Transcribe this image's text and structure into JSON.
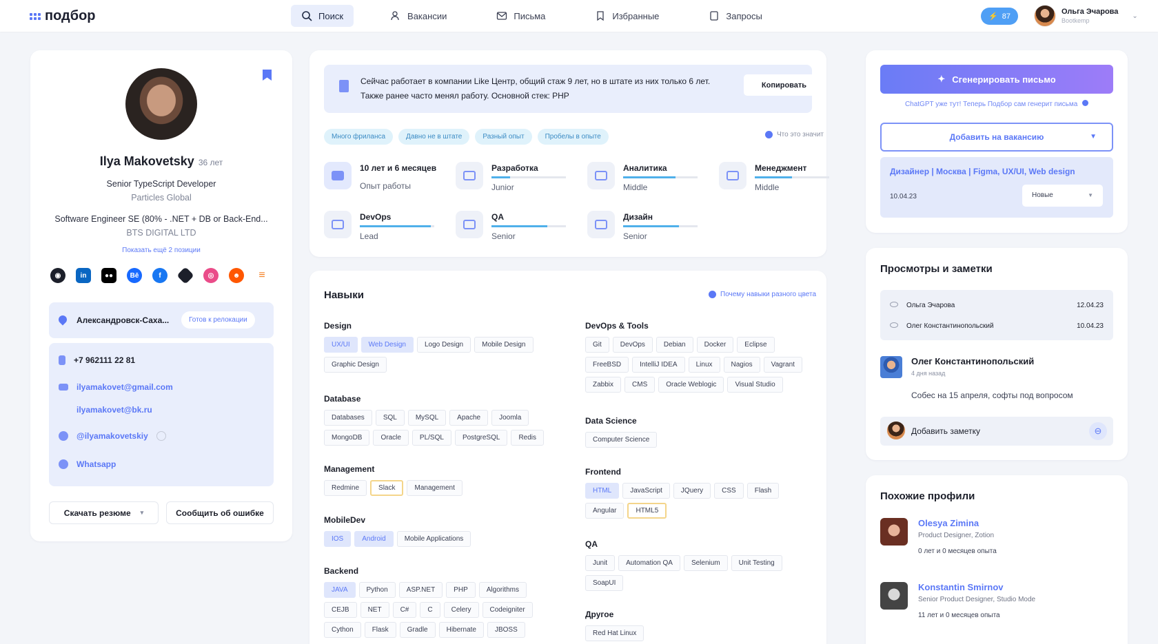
{
  "app": {
    "logo": "подбор"
  },
  "nav": [
    {
      "label": "Поиск",
      "icon": "search-icon"
    },
    {
      "label": "Вакансии",
      "icon": "people-icon"
    },
    {
      "label": "Письма",
      "icon": "mail-icon"
    },
    {
      "label": "Избранные",
      "icon": "bookmark-icon"
    },
    {
      "label": "Запросы",
      "icon": "document-icon"
    }
  ],
  "header": {
    "credits": "87",
    "user_name": "Ольга Эчарова",
    "user_role": "Bootkemp"
  },
  "profile": {
    "name": "Ilya Makovetsky",
    "age": "36 лет",
    "position": "Senior TypeScript Developer",
    "company": "Particles Global",
    "position2": "Software Engineer SE (80% - .NET + DB or Back-End...",
    "company2": "BTS DIGITAL LTD",
    "more_link": "Показать ещё 2 позиции",
    "socials": [
      "github",
      "linkedin",
      "medium",
      "behance",
      "facebook",
      "git",
      "dribbble",
      "reddit",
      "stackoverflow"
    ],
    "location": "Александровск-Саха...",
    "relocation": "Готов к релокации",
    "phone": "+7 962111 22 81",
    "email1": "ilyamakovet@gmail.com",
    "email2": "ilyamakovet@bk.ru",
    "telegram": "@ilyamakovetskiy",
    "whatsapp": "Whatsapp",
    "download": "Скачать резюме",
    "report": "Сообщить об ошибке"
  },
  "summary": {
    "text": "Сейчас работает в компании Like Центр, общий стаж 9 лет, но в штате из них только 6 лет. Также ранее часто менял работу. Основной стек: PHP",
    "copy": "Копировать",
    "tags": [
      "Много фриланса",
      "Давно не в штате",
      "Разный опыт",
      "Пробелы в опыте"
    ],
    "what": "Что это значит",
    "experience": "10 лет и 6 месяцев",
    "experience_label": "Опыт работы",
    "areas": [
      {
        "title": "Разработка",
        "level": "Junior",
        "progress": 0.25
      },
      {
        "title": "Аналитика",
        "level": "Middle",
        "progress": 0.7
      },
      {
        "title": "Менеджмент",
        "level": "Middle",
        "progress": 0.5
      },
      {
        "title": "DevOps",
        "level": "Lead",
        "progress": 0.95
      },
      {
        "title": "QA",
        "level": "Senior",
        "progress": 0.75
      },
      {
        "title": "Дизайн",
        "level": "Senior",
        "progress": 0.75
      }
    ]
  },
  "skills": {
    "title": "Навыки",
    "why": "Почему навыки разного цвета",
    "groups": [
      {
        "name": "Design",
        "items": [
          "UX/UI",
          "Web Design",
          "Logo Design",
          "Mobile Design",
          "Graphic Design"
        ],
        "hl": [
          0,
          1
        ]
      },
      {
        "name": "Database",
        "items": [
          "Databases",
          "SQL",
          "MySQL",
          "Apache",
          "Joomla",
          "MongoDB",
          "Oracle",
          "PL/SQL",
          "PostgreSQL",
          "Redis"
        ]
      },
      {
        "name": "Management",
        "items": [
          "Redmine",
          "Slack",
          "Management"
        ],
        "warn": [
          1
        ]
      },
      {
        "name": "MobileDev",
        "items": [
          "IOS",
          "Android",
          "Mobile Applications"
        ],
        "hl": [
          0,
          1
        ]
      },
      {
        "name": "Backend",
        "items": [
          "JAVA",
          "Python",
          "ASP.NET",
          "PHP",
          "Algorithms",
          "CEJB",
          "NET",
          "C#",
          "C",
          "Celery",
          "Codeigniter",
          "Cython",
          "Flask",
          "Gradle",
          "Hibernate",
          "JBOSS"
        ],
        "hl": [
          0
        ]
      },
      {
        "name": "DevOps & Tools",
        "items": [
          "Git",
          "DevOps",
          "Debian",
          "Docker",
          "Eclipse",
          "FreeBSD",
          "IntelliJ IDEA",
          "Linux",
          "Nagios",
          "Vagrant",
          "Zabbix",
          "CMS",
          "Oracle Weblogic",
          "Visual Studio"
        ]
      },
      {
        "name": "Data Science",
        "items": [
          "Computer Science"
        ]
      },
      {
        "name": "Frontend",
        "items": [
          "HTML",
          "JavaScript",
          "JQuery",
          "CSS",
          "Flash",
          "Angular",
          "HTML5"
        ],
        "hl": [
          0
        ],
        "warn": [
          6
        ]
      },
      {
        "name": "QA",
        "items": [
          "Junit",
          "Automation QA",
          "Selenium",
          "Unit Testing",
          "SoapUI"
        ]
      },
      {
        "name": "Другое",
        "items": [
          "Red Hat Linux"
        ]
      }
    ]
  },
  "actions": {
    "generate": "Сгенерировать письмо",
    "hint": "ChatGPT уже тут! Теперь Подбор сам генерит письма",
    "add_vacancy": "Добавить на вакансию",
    "vacancy_title": "Дизайнер | Москва | Figma, UX/UI, Web design",
    "vacancy_date": "10.04.23",
    "vacancy_status": "Новые"
  },
  "views": {
    "title": "Просмотры и заметки",
    "rows": [
      {
        "name": "Ольга Эчарова",
        "date": "12.04.23"
      },
      {
        "name": "Олег Константинопольский",
        "date": "10.04.23"
      }
    ],
    "note_author": "Олег Константинопольский",
    "note_time": "4 дня назад",
    "note_text": "Собес на 15 апреля, софты под вопросом",
    "add_note": "Добавить заметку"
  },
  "similar": {
    "title": "Похожие профили",
    "items": [
      {
        "name": "Olesya Zimina",
        "position": "Product Designer, Zotion",
        "exp": "0 лет и 0 месяцев опыта"
      },
      {
        "name": "Konstantin Smirnov",
        "position": "Senior Product Designer, Studio Mode",
        "exp": "11 лет и 0 месяцев опыта"
      }
    ]
  }
}
